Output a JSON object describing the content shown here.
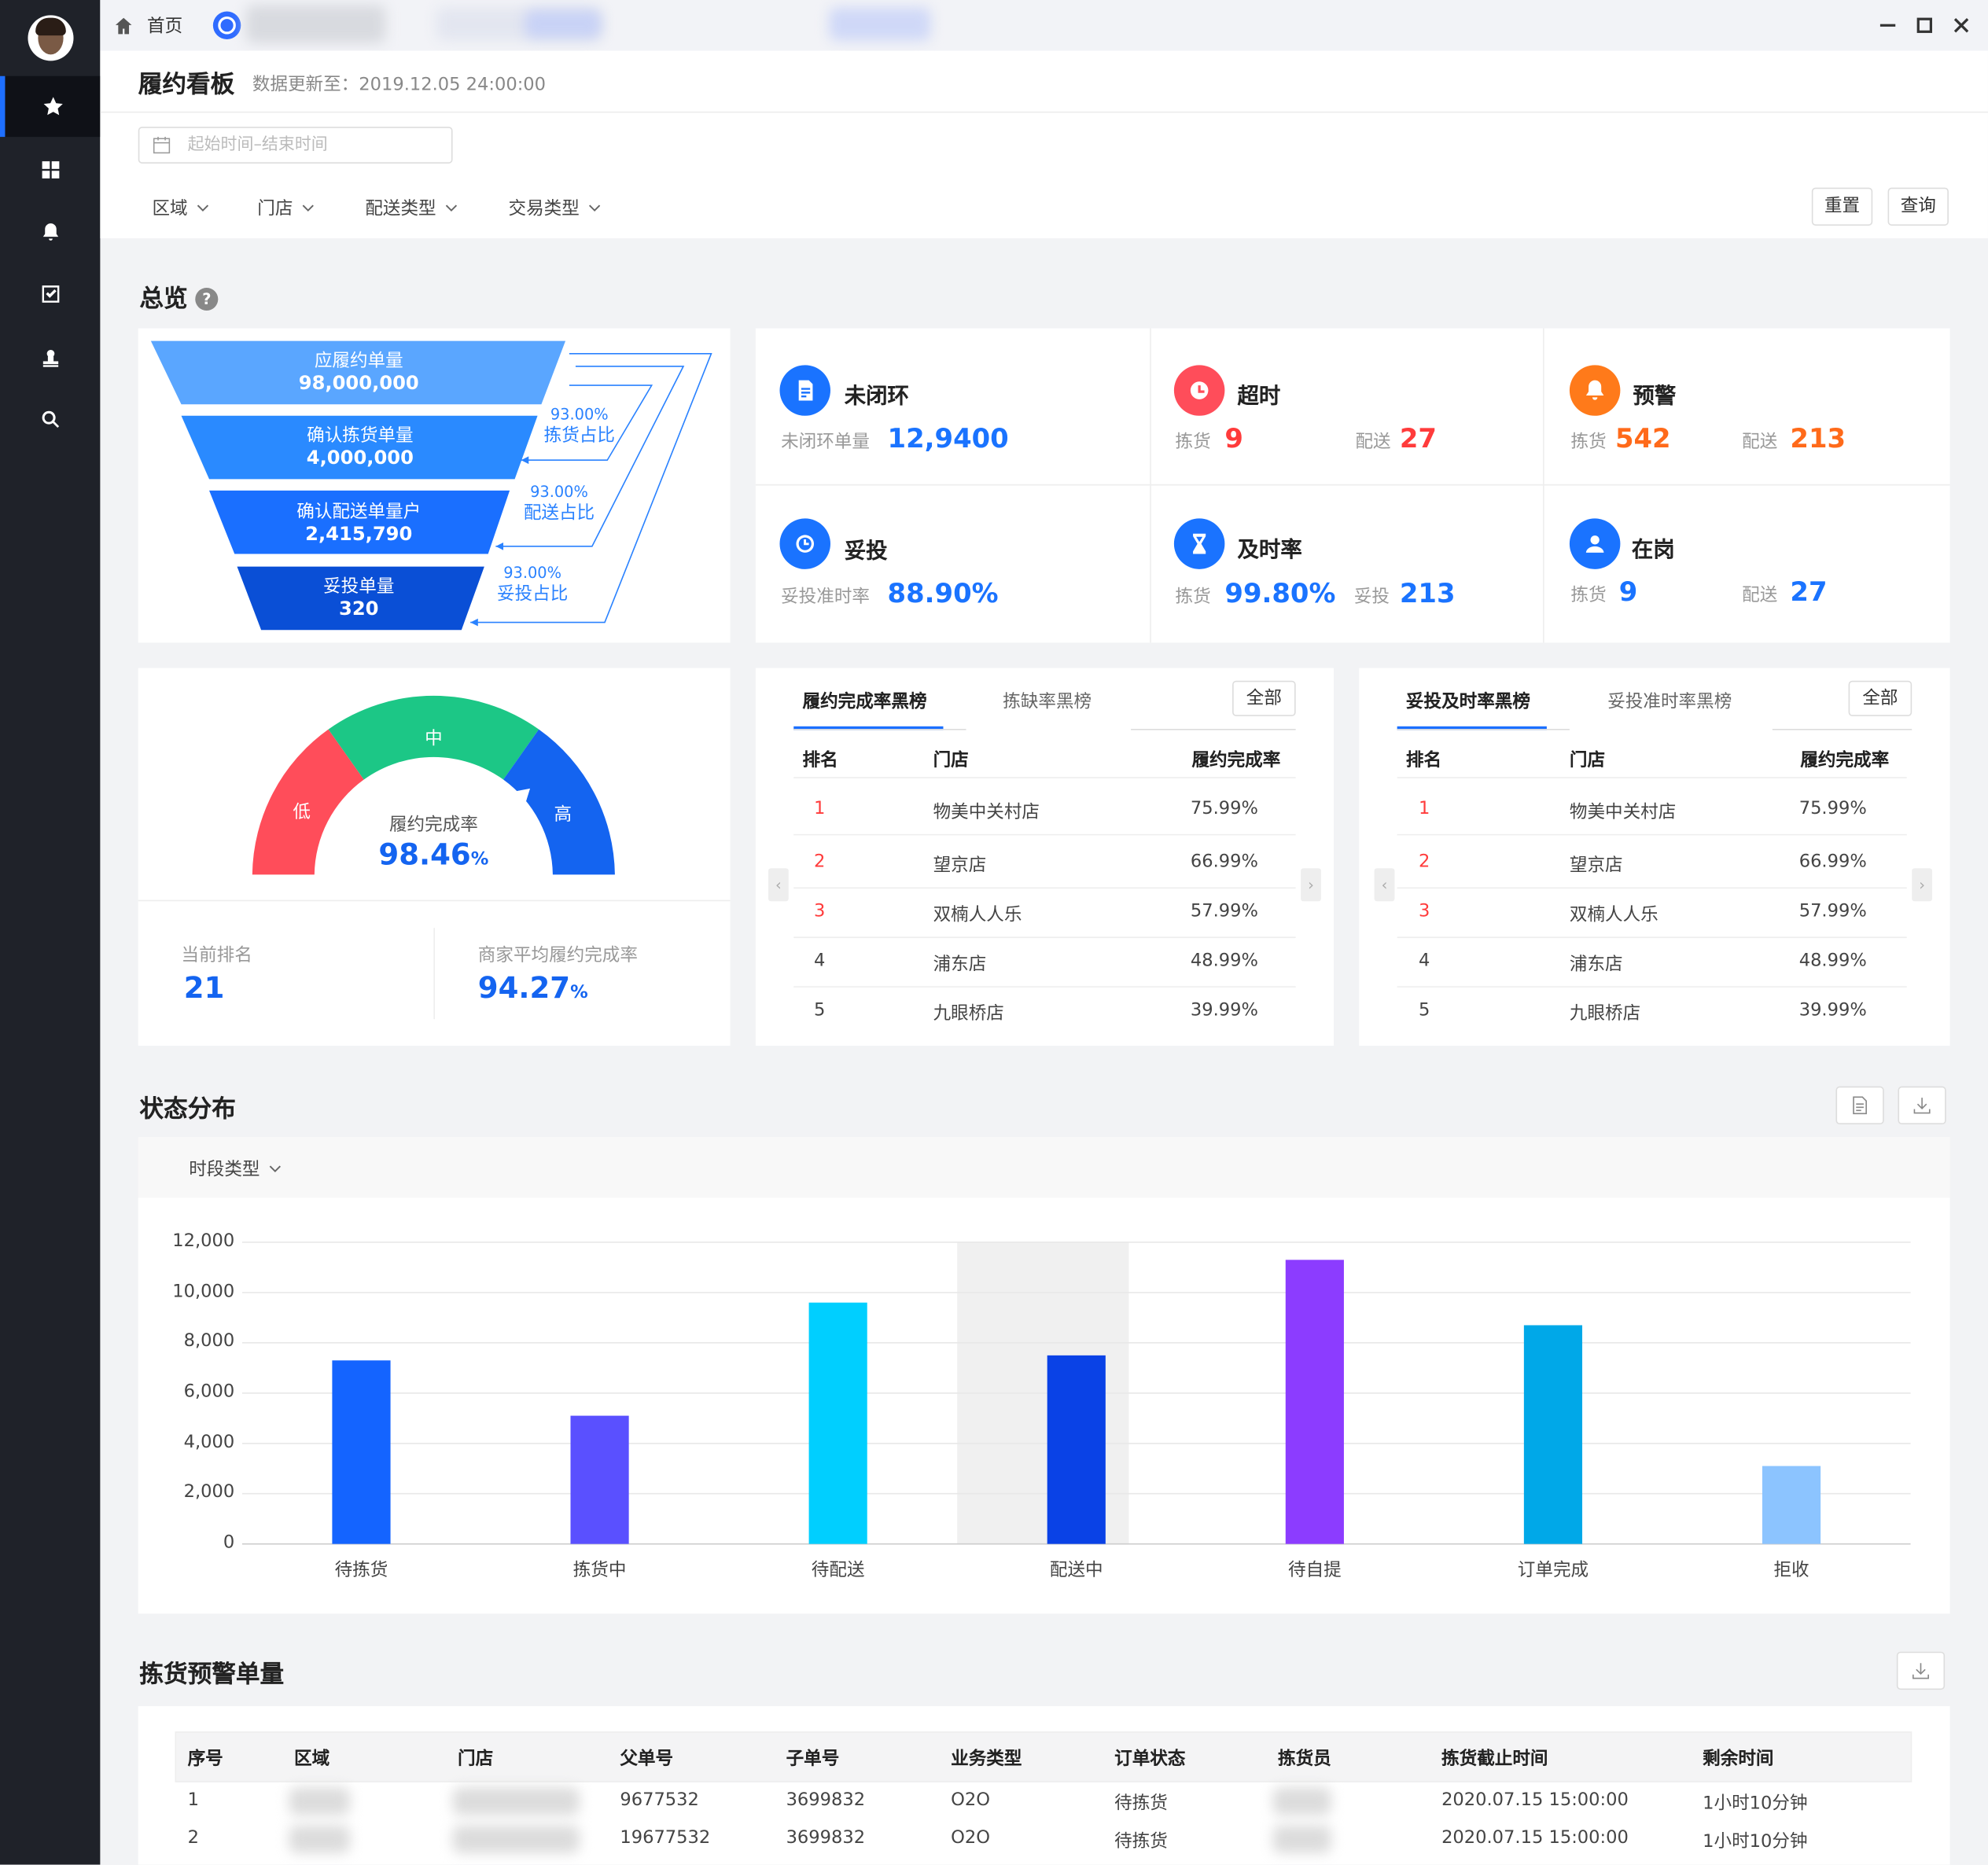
{
  "tabs": {
    "home_label": "首页"
  },
  "page": {
    "title": "履约看板",
    "update_label": "数据更新至：2019.12.05 24:00:00"
  },
  "filters": {
    "date_placeholder": "起始时间–结束时间",
    "dropdowns": [
      "区域",
      "门店",
      "配送类型",
      "交易类型"
    ],
    "reset": "重置",
    "query": "查询"
  },
  "overview": {
    "title": "总览",
    "help": "?",
    "funnel": [
      {
        "label": "应履约单量",
        "value": "98,000,000"
      },
      {
        "label": "确认拣货单量",
        "value": "4,000,000"
      },
      {
        "label": "确认配送单量户",
        "value": "2,415,790"
      },
      {
        "label": "妥投单量",
        "value": "320"
      }
    ],
    "funnel_ratios": [
      {
        "pct": "93.00%",
        "label": "拣货占比"
      },
      {
        "pct": "93.00%",
        "label": "配送占比"
      },
      {
        "pct": "93.00%",
        "label": "妥投占比"
      }
    ],
    "stats": [
      {
        "title": "未闭环",
        "icon": "document-icon",
        "color": "#1a73ff",
        "items": [
          {
            "label": "未闭环单量",
            "value": "12,9400"
          }
        ]
      },
      {
        "title": "超时",
        "icon": "clock-plus-icon",
        "color": "#ff4d5a",
        "items": [
          {
            "label": "拣货",
            "value": "9"
          },
          {
            "label": "配送",
            "value": "27"
          }
        ]
      },
      {
        "title": "预警",
        "icon": "bell-icon",
        "color": "#ff7a1a",
        "items": [
          {
            "label": "拣货",
            "value": "542"
          },
          {
            "label": "配送",
            "value": "213"
          }
        ]
      },
      {
        "title": "妥投",
        "icon": "clock-icon",
        "color": "#1a73ff",
        "items": [
          {
            "label": "妥投准时率",
            "value": "88.90%"
          }
        ]
      },
      {
        "title": "及时率",
        "icon": "hourglass-icon",
        "color": "#1a73ff",
        "items": [
          {
            "label": "拣货",
            "value": "99.80%"
          },
          {
            "label": "妥投",
            "value": "213"
          }
        ]
      },
      {
        "title": "在岗",
        "icon": "user-icon",
        "color": "#1a73ff",
        "items": [
          {
            "label": "拣货",
            "value": "9"
          },
          {
            "label": "配送",
            "value": "27"
          }
        ]
      }
    ]
  },
  "gauge": {
    "low": "低",
    "mid": "中",
    "high": "高",
    "label": "履约完成率",
    "value": "98.46",
    "unit": "%",
    "level": 0.9846,
    "rank_label": "当前排名",
    "rank_value": "21",
    "avg_label": "商家平均履约完成率",
    "avg_value": "94.27",
    "avg_unit": "%"
  },
  "ranking_left": {
    "tabs": [
      "履约完成率黑榜",
      "拣缺率黑榜"
    ],
    "all_label": "全部",
    "headers": [
      "排名",
      "门店",
      "履约完成率"
    ],
    "rows": [
      [
        "1",
        "物美中关村店",
        "75.99%"
      ],
      [
        "2",
        "望京店",
        "66.99%"
      ],
      [
        "3",
        "双楠人人乐",
        "57.99%"
      ],
      [
        "4",
        "浦东店",
        "48.99%"
      ],
      [
        "5",
        "九眼桥店",
        "39.99%"
      ]
    ]
  },
  "ranking_right": {
    "tabs": [
      "妥投及时率黑榜",
      "妥投准时率黑榜"
    ],
    "all_label": "全部",
    "headers": [
      "排名",
      "门店",
      "履约完成率"
    ],
    "rows": [
      [
        "1",
        "物美中关村店",
        "75.99%"
      ],
      [
        "2",
        "望京店",
        "66.99%"
      ],
      [
        "3",
        "双楠人人乐",
        "57.99%"
      ],
      [
        "4",
        "浦东店",
        "48.99%"
      ],
      [
        "5",
        "九眼桥店",
        "39.99%"
      ]
    ]
  },
  "status": {
    "title": "状态分布",
    "period_label": "时段类型"
  },
  "chart_data": {
    "type": "bar",
    "title": "",
    "xlabel": "",
    "ylabel": "",
    "ylim": [
      0,
      12000
    ],
    "yticks": [
      "12,000",
      "10,000",
      "8,000",
      "6,000",
      "4,000",
      "2,000",
      "0"
    ],
    "categories": [
      "待拣货",
      "拣货中",
      "待配送",
      "配送中",
      "待自提",
      "订单完成",
      "拒收"
    ],
    "values": [
      7300,
      5100,
      9600,
      7500,
      11300,
      8700,
      3100
    ],
    "colors": [
      "#1464ff",
      "#5a50ff",
      "#00cfff",
      "#0a42e6",
      "#8c3cff",
      "#00a8e8",
      "#8cc4ff"
    ],
    "highlight_index": 3
  },
  "warning": {
    "title": "拣货预警单量",
    "headers": [
      "序号",
      "区域",
      "门店",
      "父单号",
      "子单号",
      "业务类型",
      "订单状态",
      "拣货员",
      "拣货截止时间",
      "剩余时间"
    ],
    "rows": [
      [
        "1",
        "",
        "",
        "9677532",
        "3699832",
        "O2O",
        "待拣货",
        "",
        "2020.07.15 15:00:00",
        "1小时10分钟"
      ],
      [
        "2",
        "",
        "",
        "19677532",
        "3699832",
        "O2O",
        "待拣货",
        "",
        "2020.07.15 15:00:00",
        "1小时10分钟"
      ]
    ]
  }
}
